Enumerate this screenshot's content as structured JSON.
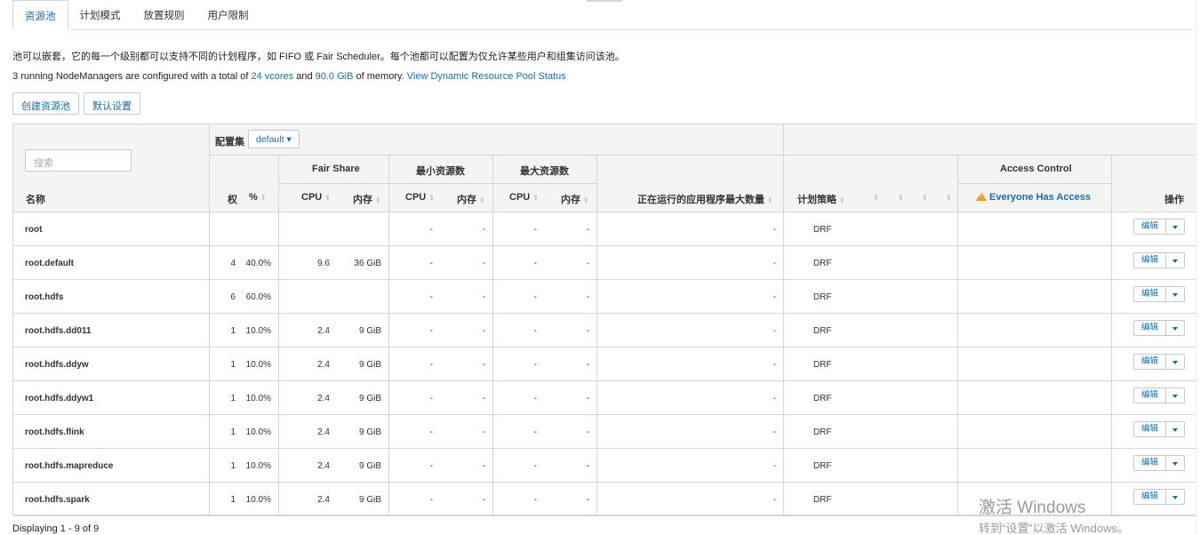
{
  "tabs": [
    {
      "label": "资源池",
      "active": true
    },
    {
      "label": "计划模式",
      "active": false
    },
    {
      "label": "放置规则",
      "active": false
    },
    {
      "label": "用户限制",
      "active": false
    }
  ],
  "description": "池可以嵌套，它的每一个级别都可以支持不同的计划程序，如 FIFO 或 Fair Scheduler。每个池都可以配置为仅允许某些用户和组集访问该池。",
  "summary": {
    "prefix": "3 running NodeManagers are configured with a total of",
    "vcores": "24 vcores",
    "and": "and",
    "memory": "90.0 GiB",
    "suffix": "of memory.",
    "status_link": "View Dynamic Resource Pool Status"
  },
  "buttons": {
    "create": "创建资源池",
    "defaults": "默认设置"
  },
  "table": {
    "search_placeholder": "搜索",
    "config_set_label": "配置集",
    "config_set_value": "default",
    "headers": {
      "name": "名称",
      "weight": "权",
      "percent": "%",
      "fair_share": "Fair Share",
      "min_resources": "最小资源数",
      "max_resources": "最大资源数",
      "cpu": "CPU",
      "memory": "内存",
      "max_running_apps": "正在运行的应用程序最大数量",
      "schedule_policy": "计划策略",
      "access_control": "Access Control",
      "access_value": "Everyone Has Access",
      "actions": "操作"
    },
    "rows": [
      {
        "name": "root",
        "weight": "",
        "percent": "",
        "fs_cpu": "",
        "fs_mem": "",
        "min_cpu": "-",
        "min_mem": "-",
        "max_cpu": "-",
        "max_mem": "-",
        "max_apps": "-",
        "policy": "DRF",
        "edit": "编辑"
      },
      {
        "name": "root.default",
        "weight": "4",
        "percent": "40.0%",
        "fs_cpu": "9.6",
        "fs_mem": "36 GiB",
        "min_cpu": "-",
        "min_mem": "-",
        "max_cpu": "-",
        "max_mem": "-",
        "max_apps": "-",
        "policy": "DRF",
        "edit": "编辑"
      },
      {
        "name": "root.hdfs",
        "weight": "6",
        "percent": "60.0%",
        "fs_cpu": "",
        "fs_mem": "",
        "min_cpu": "-",
        "min_mem": "-",
        "max_cpu": "-",
        "max_mem": "-",
        "max_apps": "-",
        "policy": "DRF",
        "edit": "编辑"
      },
      {
        "name": "root.hdfs.dd011",
        "weight": "1",
        "percent": "10.0%",
        "fs_cpu": "2.4",
        "fs_mem": "9 GiB",
        "min_cpu": "-",
        "min_mem": "-",
        "max_cpu": "-",
        "max_mem": "-",
        "max_apps": "-",
        "policy": "DRF",
        "edit": "编辑"
      },
      {
        "name": "root.hdfs.ddyw",
        "weight": "1",
        "percent": "10.0%",
        "fs_cpu": "2.4",
        "fs_mem": "9 GiB",
        "min_cpu": "-",
        "min_mem": "-",
        "max_cpu": "-",
        "max_mem": "-",
        "max_apps": "-",
        "policy": "DRF",
        "edit": "编辑"
      },
      {
        "name": "root.hdfs.ddyw1",
        "weight": "1",
        "percent": "10.0%",
        "fs_cpu": "2.4",
        "fs_mem": "9 GiB",
        "min_cpu": "-",
        "min_mem": "-",
        "max_cpu": "-",
        "max_mem": "-",
        "max_apps": "-",
        "policy": "DRF",
        "edit": "编辑"
      },
      {
        "name": "root.hdfs.flink",
        "weight": "1",
        "percent": "10.0%",
        "fs_cpu": "2.4",
        "fs_mem": "9 GiB",
        "min_cpu": "-",
        "min_mem": "-",
        "max_cpu": "-",
        "max_mem": "-",
        "max_apps": "-",
        "policy": "DRF",
        "edit": "编辑"
      },
      {
        "name": "root.hdfs.mapreduce",
        "weight": "1",
        "percent": "10.0%",
        "fs_cpu": "2.4",
        "fs_mem": "9 GiB",
        "min_cpu": "-",
        "min_mem": "-",
        "max_cpu": "-",
        "max_mem": "-",
        "max_apps": "-",
        "policy": "DRF",
        "edit": "编辑"
      },
      {
        "name": "root.hdfs.spark",
        "weight": "1",
        "percent": "10.0%",
        "fs_cpu": "2.4",
        "fs_mem": "9 GiB",
        "min_cpu": "-",
        "min_mem": "-",
        "max_cpu": "-",
        "max_mem": "-",
        "max_apps": "-",
        "policy": "DRF",
        "edit": "编辑"
      }
    ]
  },
  "footer": "Displaying 1 - 9 of 9",
  "watermark": {
    "line1": "激活 Windows",
    "line2": "转到“设置”以激活 Windows。"
  },
  "colors": {
    "link": "#1a6ca8",
    "warning": "#e89a2b",
    "header_bg": "#f4f4f4",
    "border": "#d6d6d6"
  }
}
